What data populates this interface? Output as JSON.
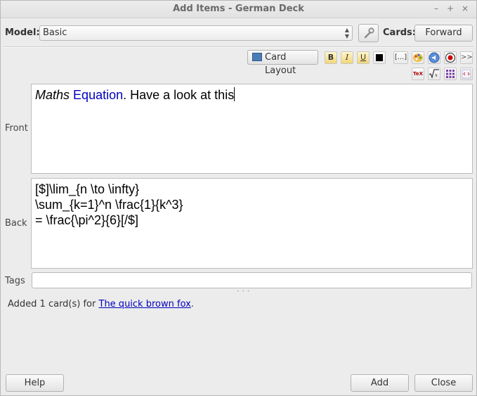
{
  "window": {
    "title": "Add Items - German Deck"
  },
  "model": {
    "label": "Model:",
    "value": "Basic"
  },
  "cards": {
    "label": "Cards:",
    "value": "Forward"
  },
  "toolbar": {
    "card_layout": "Card Layout",
    "bold": "B",
    "italic": "I",
    "underline": "U",
    "cloze": "[...]",
    "more": ">>",
    "tex": "TeX"
  },
  "fields": {
    "front": {
      "label": "Front",
      "italic": "Maths",
      "colored": "Equation",
      "rest": ". Have a look at this"
    },
    "back": {
      "label": "Back",
      "lines": [
        "[$]\\lim_{n \\to \\infty}",
        "\\sum_{k=1}^n \\frac{1}{k^3}",
        "= \\frac{\\pi^2}{6}[/$]"
      ]
    }
  },
  "tags": {
    "label": "Tags",
    "value": ""
  },
  "status": {
    "prefix": "Added 1 card(s) for ",
    "link": "The quick brown fox",
    "suffix": "."
  },
  "buttons": {
    "help": "Help",
    "add": "Add",
    "close": "Close"
  },
  "colors": {
    "equation_text": "#0000c0",
    "link": "#0000c0"
  }
}
